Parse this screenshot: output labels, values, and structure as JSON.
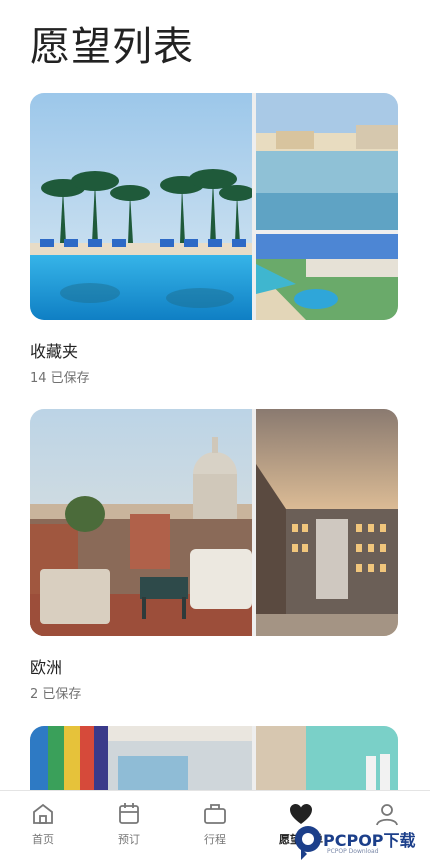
{
  "page": {
    "title": "愿望列表"
  },
  "collections": [
    {
      "title": "收藏夹",
      "subtitle": "14 已保存"
    },
    {
      "title": "欧洲",
      "subtitle": "2 已保存"
    }
  ],
  "tabbar": {
    "items": [
      {
        "label": "首页",
        "icon": "home-icon",
        "active": false
      },
      {
        "label": "预订",
        "icon": "calendar-icon",
        "active": false
      },
      {
        "label": "行程",
        "icon": "suitcase-icon",
        "active": false
      },
      {
        "label": "愿望清单",
        "icon": "heart-icon",
        "active": true
      },
      {
        "label": "",
        "icon": "person-icon",
        "active": false
      }
    ]
  },
  "watermark": {
    "brand": "PCPOP下载",
    "small": "PCPOP Download"
  },
  "colors": {
    "active_heart": "#222222",
    "inactive_icon": "#777777"
  }
}
